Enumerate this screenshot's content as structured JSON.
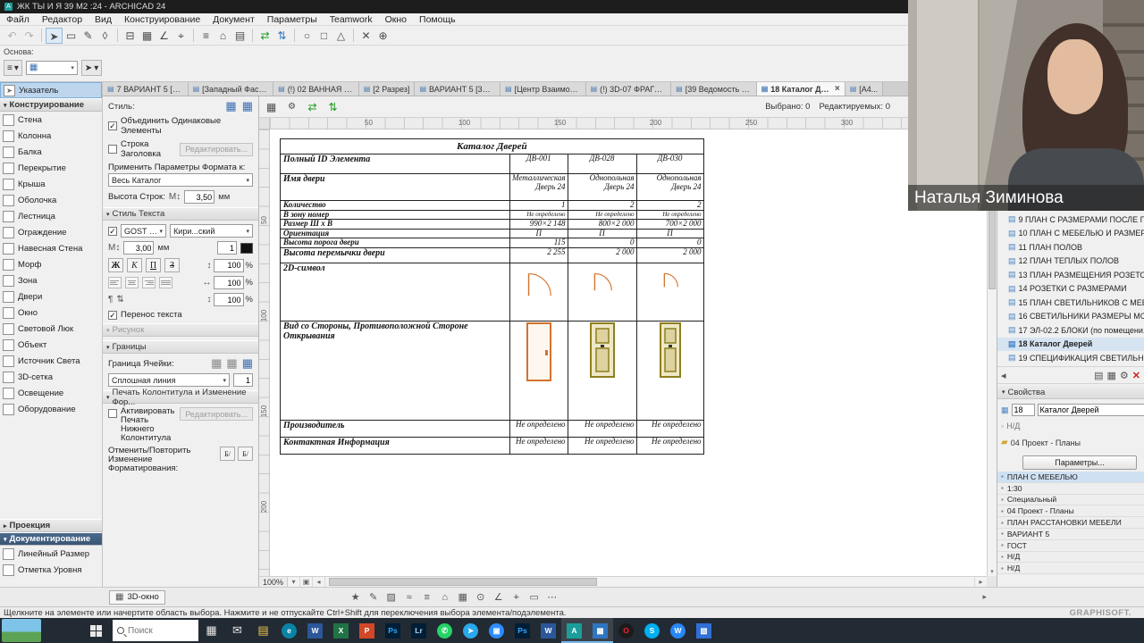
{
  "window": {
    "title": "ЖК ТЫ И Я 39 М2 :24 - ARCHICAD 24"
  },
  "menu": [
    "Файл",
    "Редактор",
    "Вид",
    "Конструирование",
    "Документ",
    "Параметры",
    "Teamwork",
    "Окно",
    "Помощь"
  ],
  "toolbar_icons": [
    {
      "name": "undo-icon",
      "glyph": "↶",
      "dim": true
    },
    {
      "name": "redo-icon",
      "glyph": "↷",
      "dim": true
    },
    {
      "name": "separator",
      "sep": true
    },
    {
      "name": "select-arrow-icon",
      "glyph": "➤",
      "boxed": true
    },
    {
      "name": "marquee-icon",
      "glyph": "▭"
    },
    {
      "name": "pencil-icon",
      "glyph": "✎"
    },
    {
      "name": "eraser-icon",
      "glyph": "◊"
    },
    {
      "name": "separator",
      "sep": true
    },
    {
      "name": "wall-tool-icon",
      "glyph": "⊟"
    },
    {
      "name": "grid-snap-icon",
      "glyph": "▦"
    },
    {
      "name": "guide-angle-icon",
      "glyph": "∠"
    },
    {
      "name": "snap-point-icon",
      "glyph": "⌖"
    },
    {
      "name": "separator",
      "sep": true
    },
    {
      "name": "layers-icon",
      "glyph": "≡"
    },
    {
      "name": "stories-icon",
      "glyph": "⌂"
    },
    {
      "name": "views-icon",
      "glyph": "▤"
    },
    {
      "name": "separator",
      "sep": true
    },
    {
      "name": "transfer-settings-icon",
      "glyph": "⇄",
      "color": "#1d9a1d"
    },
    {
      "name": "sync-icon",
      "glyph": "⇅",
      "color": "#2f76c2"
    },
    {
      "name": "separator",
      "sep": true
    },
    {
      "name": "circle-tool-icon",
      "glyph": "○"
    },
    {
      "name": "rect-tool-icon",
      "glyph": "□"
    },
    {
      "name": "poly-tool-icon",
      "glyph": "△"
    },
    {
      "name": "separator",
      "sep": true
    },
    {
      "name": "delete-icon",
      "glyph": "✕"
    },
    {
      "name": "measure-icon",
      "glyph": "⊕"
    }
  ],
  "toolbar_sub": {
    "basis_label": "Основа:"
  },
  "tabs": [
    {
      "label": "7 ВАРИАНТ 5 [1. 1...",
      "active": false
    },
    {
      "label": "[Западный Фасад]",
      "active": false
    },
    {
      "label": "(!) 02 ВАННАЯ [02...",
      "active": false
    },
    {
      "label": "[2 Разрез]",
      "active": false
    },
    {
      "label": "ВАРИАНТ 5 [3D / ...",
      "active": false
    },
    {
      "label": "[Центр Взаимоде...",
      "active": false
    },
    {
      "label": "(!) 3D-07 ФРАГМЕ...",
      "active": false
    },
    {
      "label": "[39 Ведомость дв...",
      "active": false
    },
    {
      "label": "18 Каталог Двер...",
      "active": true
    },
    {
      "label": "[A4...",
      "active": false
    }
  ],
  "canvas_strip": {
    "selected": "Выбрано: 0",
    "editable": "Редактируемых: 0"
  },
  "ruler": {
    "top": [
      "50",
      "100",
      "150",
      "200",
      "250",
      "300"
    ],
    "left": [
      "50",
      "100",
      "150",
      "200"
    ]
  },
  "toolbox": {
    "pointer": "Указатель",
    "construct_header": "Конструирование",
    "construct_items": [
      "Стена",
      "Колонна",
      "Балка",
      "Перекрытие",
      "Крыша",
      "Оболочка",
      "Лестница",
      "Ограждение",
      "Навесная Стена",
      "Морф",
      "Зона",
      "Двери",
      "Окно",
      "Световой Люк",
      "Объект",
      "Источник Света",
      "3D-сетка",
      "Освещение",
      "Оборудование"
    ],
    "projection_header": "Проекция",
    "documentation_header": "Документирование",
    "doc_items": [
      "Линейный Размер",
      "Отметка Уровня"
    ]
  },
  "settings": {
    "style_label": "Стиль:",
    "merge_checkbox": "Объединить Одинаковые Элементы",
    "header_row_checkbox": "Строка Заголовка",
    "edit_button": "Редактировать...",
    "apply_label": "Применить Параметры Формата к:",
    "apply_value": "Весь Каталог",
    "row_height_label": "Высота Строк:",
    "row_height_value": "3,50",
    "unit_mm": "мм",
    "text_style_section": "Стиль Текста",
    "font_name": "GOST Common",
    "font_script": "Кири...ский",
    "font_size": "3,00",
    "pen_value": "1",
    "bold": "Ж",
    "italic": "К",
    "underline": "П",
    "strike": "З",
    "pct1": "100",
    "pct2": "100",
    "pct3": "100",
    "pct_unit": "%",
    "wrap_checkbox": "Перенос текста",
    "picture_section": "Рисунок",
    "borders_section": "Границы",
    "cell_border_label": "Граница Ячейки:",
    "line_type": "Сплошная линия",
    "line_pen": "1",
    "footer_section": "Печать Колонтитула и Изменение Фор...",
    "footer_checkbox": "Активировать Печать Нижнего Колонтитула",
    "undo_label": "Отменить/Повторить Изменение Форматирования:"
  },
  "schedule": {
    "title": "Каталог Дверей",
    "rows": {
      "id": {
        "label": "Полный ID Элемента",
        "values": [
          "ДВ-001",
          "ДВ-028",
          "ДВ-030"
        ]
      },
      "name": {
        "label": "Имя двери",
        "values": [
          "Металлическая Дверь 24",
          "Однопольная Дверь 24",
          "Однопольная Дверь 24"
        ]
      },
      "qty": {
        "label": "Количество",
        "values": [
          "1",
          "2",
          "2"
        ]
      },
      "zone": {
        "label": "В зону номер",
        "values": [
          "Не определено",
          "Не определено",
          "Не определено"
        ]
      },
      "size": {
        "label": "Размер Ш х В",
        "values": [
          "990×2 148",
          "800×2 000",
          "700×2 000"
        ]
      },
      "orient": {
        "label": "Ориентация",
        "values": [
          "П",
          "П",
          "П"
        ]
      },
      "sill": {
        "label": "Высота порога двери",
        "values": [
          "115",
          "0",
          "0"
        ]
      },
      "lintel": {
        "label": "Высота перемычки двери",
        "values": [
          "2 255",
          "2 000",
          "2 000"
        ]
      },
      "symbol": {
        "label": "2D-символ"
      },
      "view": {
        "label": "Вид со Стороны, Противоположной Стороне Открывания"
      },
      "manufacturer": {
        "label": "Производитель",
        "values": [
          "Не определено",
          "Не определено",
          "Не определено"
        ]
      },
      "contact": {
        "label": "Контактная Информация",
        "values": [
          "Не определено",
          "Не определено",
          "Не определено"
        ]
      }
    }
  },
  "viewport": {
    "zoom": "100%"
  },
  "bottom_bar": {
    "button_3d": "3D-окно"
  },
  "bottom_icons": [
    {
      "name": "favorites-icon",
      "glyph": "★"
    },
    {
      "name": "pen-color-icon",
      "glyph": "✎"
    },
    {
      "name": "fill-type-icon",
      "glyph": "▨"
    },
    {
      "name": "line-type-icon",
      "glyph": "≈"
    },
    {
      "name": "layers-icon",
      "glyph": "≡"
    },
    {
      "name": "story-icon",
      "glyph": "⌂"
    },
    {
      "name": "grid-icon",
      "glyph": "▦"
    },
    {
      "name": "snap-icon",
      "glyph": "⊙"
    },
    {
      "name": "angle-icon",
      "glyph": "∠"
    },
    {
      "name": "tracker-icon",
      "glyph": "⌖"
    },
    {
      "name": "frame-icon",
      "glyph": "▭"
    },
    {
      "name": "more-options-icon",
      "glyph": "⋯"
    }
  ],
  "status_bar": {
    "hint": "Щелкните на элементе или начертите область выбора. Нажмите и не отпускайте Ctrl+Shift для переключения выбора элемента/подэлемента.",
    "brand": "GRAPHISOFT."
  },
  "navigator": {
    "items": [
      {
        "label": "9 ПЛАН С РАЗМЕРАМИ ПОСЛЕ Г...",
        "active": false
      },
      {
        "label": "10 ПЛАН С МЕБЕЛЬЮ И РАЗМЕР...",
        "active": false
      },
      {
        "label": "11 ПЛАН ПОЛОВ",
        "active": false
      },
      {
        "label": "12 ПЛАН ТЕПЛЫХ ПОЛОВ",
        "active": false
      },
      {
        "label": "13 ПЛАН РАЗМЕЩЕНИЯ РОЗЕТО...",
        "active": false
      },
      {
        "label": "14 РОЗЕТКИ С РАЗМЕРАМИ",
        "active": false
      },
      {
        "label": "15 ПЛАН СВЕТИЛЬНИКОВ С МЕБ...",
        "active": false
      },
      {
        "label": "16 СВЕТИЛЬНИКИ РАЗМЕРЫ МО...",
        "active": false
      },
      {
        "label": "17 ЭЛ-02.2 БЛОКИ (по помещени...",
        "active": false
      },
      {
        "label": "18 Каталог Дверей",
        "active": true
      },
      {
        "label": "19 СПЕЦИФИКАЦИЯ СВЕТИЛЬНИ...",
        "active": false
      }
    ],
    "properties_header": "Свойства",
    "prop_id": "18",
    "prop_name": "Каталог Дверей",
    "prop_na": "Н/Д",
    "prop_folder": "04 Проект - Планы",
    "params_button": "Параметры...",
    "info_rows": [
      {
        "label": "ПЛАН С МЕБЕЛЬЮ",
        "selected": true
      },
      {
        "label": "1:30",
        "selected": false
      },
      {
        "label": "Специальный",
        "selected": false
      },
      {
        "label": "04 Проект - Планы",
        "selected": false
      },
      {
        "label": "ПЛАН РАССТАНОВКИ МЕБЕЛИ",
        "selected": false
      },
      {
        "label": "ВАРИАНТ 5",
        "selected": false
      },
      {
        "label": "ГОСТ",
        "selected": false
      },
      {
        "label": "Н/Д",
        "selected": false
      },
      {
        "label": "Н/Д",
        "selected": false
      }
    ]
  },
  "webcam": {
    "caption": "Наталья Зиминова"
  },
  "taskbar": {
    "search_placeholder": "Поиск",
    "icons": [
      {
        "name": "task-view-icon",
        "glyph": "▦",
        "flat": true,
        "fg": "#e6e6e6"
      },
      {
        "name": "mail-icon",
        "glyph": "✉",
        "flat": true,
        "fg": "#e6e6e6"
      },
      {
        "name": "file-explorer-icon",
        "glyph": "▤",
        "flat": true,
        "fg": "#f3c44d"
      },
      {
        "name": "edge-icon",
        "glyph": "e",
        "bg": "#0a84a5",
        "round": true
      },
      {
        "name": "word-icon",
        "glyph": "W",
        "bg": "#2b579a"
      },
      {
        "name": "excel-icon",
        "glyph": "X",
        "bg": "#217346"
      },
      {
        "name": "powerpoint-icon",
        "glyph": "P",
        "bg": "#d24726"
      },
      {
        "name": "photoshop-icon",
        "glyph": "Ps",
        "bg": "#001e36",
        "fg": "#31a8ff"
      },
      {
        "name": "lightroom-icon",
        "glyph": "Lr",
        "bg": "#001e36",
        "fg": "#add5ec"
      },
      {
        "name": "whatsapp-icon",
        "glyph": "✆",
        "bg": "#25d366",
        "round": true
      },
      {
        "name": "telegram-icon",
        "glyph": "➤",
        "bg": "#29a9eb",
        "round": true
      },
      {
        "name": "zoom-icon",
        "glyph": "▣",
        "bg": "#2d8cff",
        "round": true
      },
      {
        "name": "photoshop2-icon",
        "glyph": "Ps",
        "bg": "#001e36",
        "fg": "#31a8ff"
      },
      {
        "name": "word2-icon",
        "glyph": "W",
        "bg": "#2b579a"
      },
      {
        "name": "archicad-icon",
        "glyph": "A",
        "bg": "#1b9e9b",
        "active": true
      },
      {
        "name": "archicad-file-icon",
        "glyph": "▦",
        "bg": "#2f76c2",
        "active": true
      },
      {
        "name": "opera-icon",
        "glyph": "O",
        "bg": "#1c1c1c",
        "fg": "#ff1b2d",
        "round": true
      },
      {
        "name": "skype-icon",
        "glyph": "S",
        "bg": "#00aff0",
        "round": true
      },
      {
        "name": "vk-icon",
        "glyph": "W",
        "bg": "#2787f5",
        "round": true
      },
      {
        "name": "paint-icon",
        "glyph": "▧",
        "bg": "#2f6fd6"
      }
    ]
  },
  "colors": {
    "accent": "#2f76c2",
    "door_symbol": "#d4722c",
    "door_panel": "#8e7f1e"
  }
}
